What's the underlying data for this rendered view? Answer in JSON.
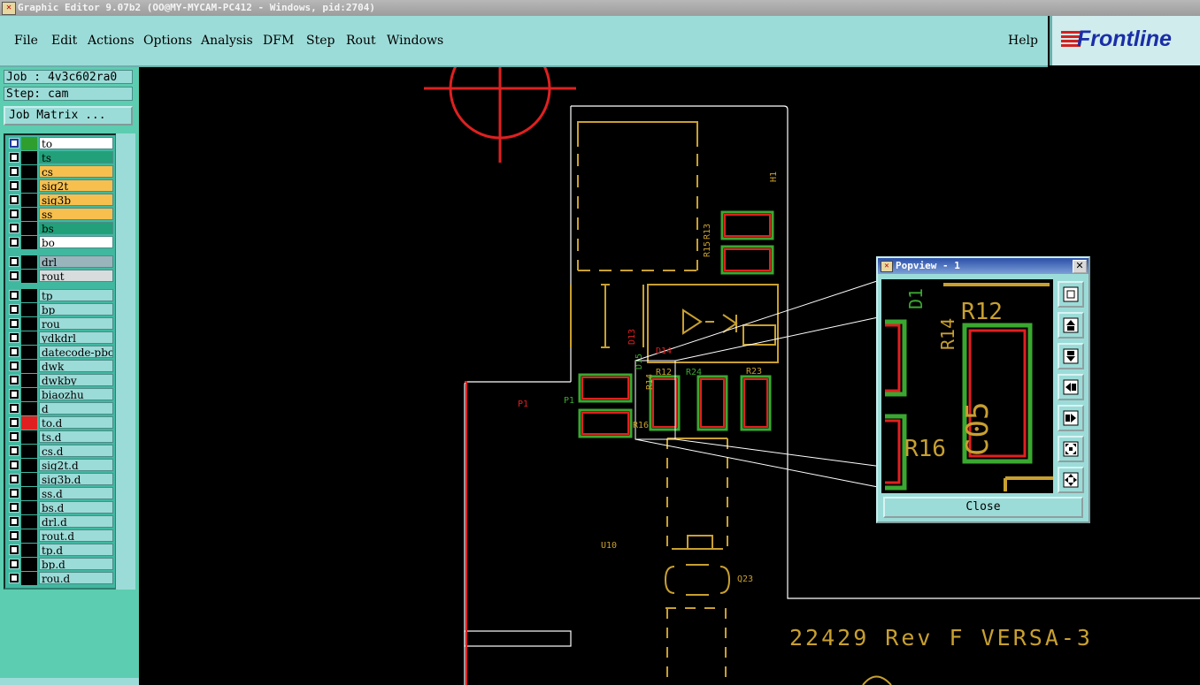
{
  "window": {
    "title": "Graphic Editor 9.07b2 (OO@MY-MYCAM-PC412 - Windows, pid:2704)",
    "icon": "app-x-icon"
  },
  "menu": {
    "items": [
      "File",
      "Edit",
      "Actions",
      "Options",
      "Analysis",
      "DFM",
      "Step",
      "Rout",
      "Windows"
    ],
    "help": "Help"
  },
  "brand": {
    "name": "Frontline",
    "icon": "frontline-stripes-icon"
  },
  "job": {
    "label": "Job : 4v3c602ra0",
    "step": "Step: cam",
    "matrix_button": "Job Matrix ..."
  },
  "layers": [
    {
      "name": "to",
      "color": "#ffffff",
      "swatch": "#2e9e2e",
      "checked": true
    },
    {
      "name": "ts",
      "color": "#21a079",
      "swatch": "#000000",
      "checked": false
    },
    {
      "name": "cs",
      "color": "#f7c04e",
      "swatch": "#000000",
      "checked": false
    },
    {
      "name": "sig2t",
      "color": "#f7c04e",
      "swatch": "#000000",
      "checked": false
    },
    {
      "name": "sig3b",
      "color": "#f7c04e",
      "swatch": "#000000",
      "checked": false
    },
    {
      "name": "ss",
      "color": "#f7c04e",
      "swatch": "#000000",
      "checked": false
    },
    {
      "name": "bs",
      "color": "#21a079",
      "swatch": "#000000",
      "checked": false
    },
    {
      "name": "bo",
      "color": "#ffffff",
      "swatch": "#000000",
      "checked": false
    },
    {
      "name": "drl",
      "color": "#9ab4bc",
      "swatch": "#000000",
      "checked": false
    },
    {
      "name": "rout",
      "color": "#d8dcdc",
      "swatch": "#000000",
      "checked": false
    },
    {
      "name": "tp",
      "color": "#9cdcd8",
      "swatch": "#000000",
      "checked": false
    },
    {
      "name": "bp",
      "color": "#9cdcd8",
      "swatch": "#000000",
      "checked": false
    },
    {
      "name": "rou",
      "color": "#9cdcd8",
      "swatch": "#000000",
      "checked": false
    },
    {
      "name": "ydkdrl",
      "color": "#9cdcd8",
      "swatch": "#000000",
      "checked": false
    },
    {
      "name": "datecode-pbc",
      "color": "#9cdcd8",
      "swatch": "#000000",
      "checked": false
    },
    {
      "name": "dwk",
      "color": "#9cdcd8",
      "swatch": "#000000",
      "checked": false
    },
    {
      "name": "dwkby",
      "color": "#9cdcd8",
      "swatch": "#000000",
      "checked": false
    },
    {
      "name": "biaozhu",
      "color": "#9cdcd8",
      "swatch": "#000000",
      "checked": false
    },
    {
      "name": "d",
      "color": "#9cdcd8",
      "swatch": "#000000",
      "checked": false
    },
    {
      "name": "to.d",
      "color": "#9cdcd8",
      "swatch": "#e02020",
      "checked": false
    },
    {
      "name": "ts.d",
      "color": "#9cdcd8",
      "swatch": "#000000",
      "checked": false
    },
    {
      "name": "cs.d",
      "color": "#9cdcd8",
      "swatch": "#000000",
      "checked": false
    },
    {
      "name": "sig2t.d",
      "color": "#9cdcd8",
      "swatch": "#000000",
      "checked": false
    },
    {
      "name": "sig3b.d",
      "color": "#9cdcd8",
      "swatch": "#000000",
      "checked": false
    },
    {
      "name": "ss.d",
      "color": "#9cdcd8",
      "swatch": "#000000",
      "checked": false
    },
    {
      "name": "bs.d",
      "color": "#9cdcd8",
      "swatch": "#000000",
      "checked": false
    },
    {
      "name": "drl.d",
      "color": "#9cdcd8",
      "swatch": "#000000",
      "checked": false
    },
    {
      "name": "rout.d",
      "color": "#9cdcd8",
      "swatch": "#000000",
      "checked": false
    },
    {
      "name": "tp.d",
      "color": "#9cdcd8",
      "swatch": "#000000",
      "checked": false
    },
    {
      "name": "bp.d",
      "color": "#9cdcd8",
      "swatch": "#000000",
      "checked": false
    },
    {
      "name": "rou.d",
      "color": "#9cdcd8",
      "swatch": "#000000",
      "checked": false
    }
  ],
  "canvas": {
    "colors": {
      "background": "#000000",
      "silk": "#c8a030",
      "pad_red": "#e02020",
      "pad_green": "#3aa830",
      "outline": "#ffffff"
    },
    "labels": {
      "h1": "H1",
      "r15": "R15",
      "r13": "R13",
      "d13": "D13",
      "d14": "D14",
      "d15": "D15",
      "r12": "R12",
      "r24": "R24",
      "r23": "R23",
      "r14": "R14",
      "r16": "R16",
      "p1": "P1",
      "p1b": "P1",
      "u10": "U10",
      "q23": "Q23",
      "rev": "22429 Rev F VERSA-3"
    }
  },
  "popview": {
    "title": "Popview - 1",
    "close_label": "Close",
    "labels": {
      "d1": "D1",
      "r12": "R12",
      "r14": "R14",
      "r16": "R16",
      "c05": "C05"
    },
    "tools": [
      "zoom-fit-icon",
      "pan-up-icon",
      "pan-down-icon",
      "pan-left-icon",
      "pan-right-icon",
      "zoom-in-icon",
      "zoom-out-icon"
    ]
  }
}
